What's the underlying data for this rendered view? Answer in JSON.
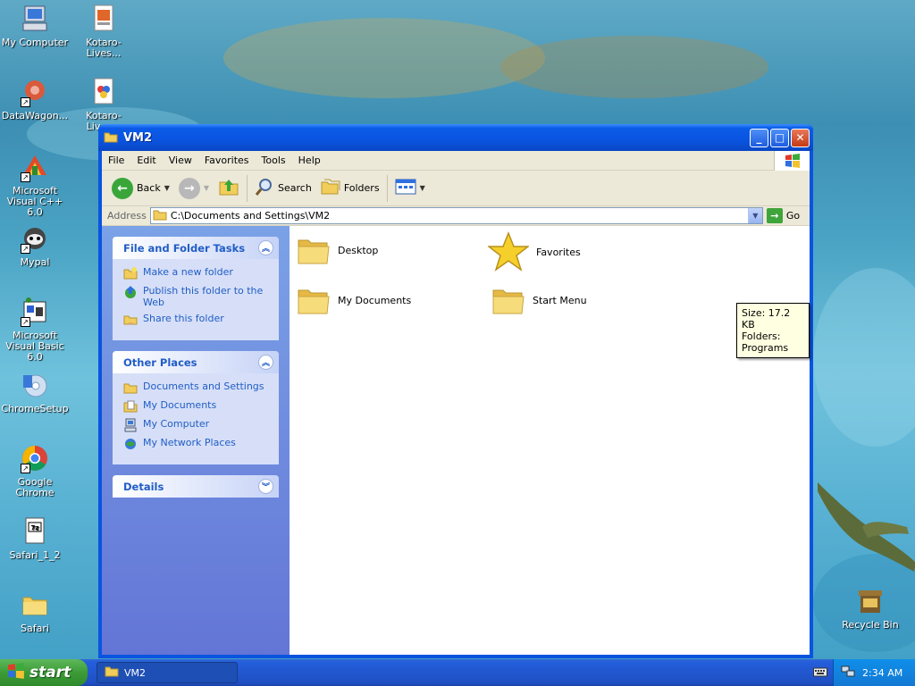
{
  "desktop": {
    "icons": [
      {
        "label": "My Computer"
      },
      {
        "label": "Kotaro-Lives..."
      },
      {
        "label": "DataWagon..."
      },
      {
        "label": "Kotaro-Lives..."
      },
      {
        "label": "Microsoft Visual C++ 6.0"
      },
      {
        "label": "Mypal"
      },
      {
        "label": "Microsoft Visual Basic 6.0"
      },
      {
        "label": "ChromeSetup"
      },
      {
        "label": "Google Chrome"
      },
      {
        "label": "Safari_1_2"
      },
      {
        "label": "Safari"
      },
      {
        "label": "Recycle Bin"
      }
    ]
  },
  "window": {
    "title": "VM2",
    "menu": [
      "File",
      "Edit",
      "View",
      "Favorites",
      "Tools",
      "Help"
    ],
    "toolbar": {
      "back_label": "Back",
      "search_label": "Search",
      "folders_label": "Folders"
    },
    "address": {
      "label": "Address",
      "value": "C:\\Documents and Settings\\VM2",
      "go_label": "Go"
    },
    "left_pane": {
      "file_tasks": {
        "title": "File and Folder Tasks",
        "items": [
          "Make a new folder",
          "Publish this folder to the Web",
          "Share this folder"
        ]
      },
      "other_places": {
        "title": "Other Places",
        "items": [
          "Documents and Settings",
          "My Documents",
          "My Computer",
          "My Network Places"
        ]
      },
      "details": {
        "title": "Details"
      }
    },
    "items": [
      {
        "label": "Desktop"
      },
      {
        "label": "Favorites"
      },
      {
        "label": "My Documents"
      },
      {
        "label": "Start Menu"
      }
    ],
    "tooltip": {
      "line1": "Size: 17.2 KB",
      "line2": "Folders: Programs"
    }
  },
  "taskbar": {
    "start_label": "start",
    "task_label": "VM2",
    "clock": "2:34 AM"
  }
}
